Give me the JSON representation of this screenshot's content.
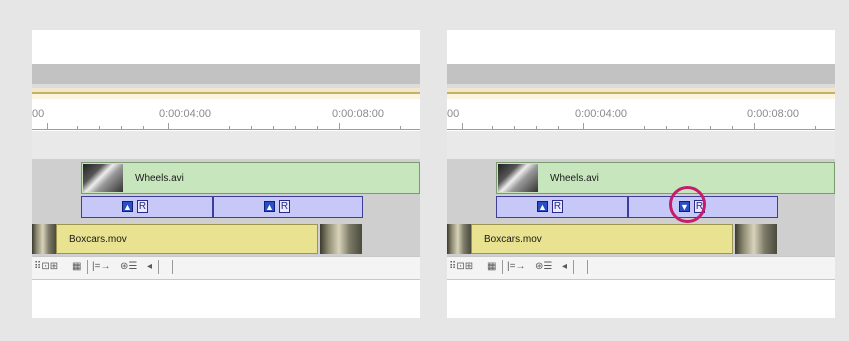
{
  "colors": {
    "background": "#e6e6e6",
    "video_clip": "#c7e6bd",
    "audio_clip": "#e8e291",
    "transition": "#c8c8f8",
    "highlight_ring": "#c61c6b"
  },
  "panels": [
    {
      "ruler": {
        "ticks": [
          "00",
          "0:00:04:00",
          "0:00:08:00"
        ]
      },
      "video_clip": {
        "name": "Wheels.avi"
      },
      "transitions": [
        {
          "direction": "up",
          "icon": "up-arrow-icon"
        },
        {
          "direction": "up",
          "icon": "up-arrow-icon"
        }
      ],
      "audio_clip": {
        "name": "Boxcars.mov"
      },
      "toolbar": {
        "icons": [
          "track-options-icon",
          "toggle-icon",
          "ruler-icon",
          "arrow-icon",
          "grid-icon",
          "scroll-left-icon"
        ]
      }
    },
    {
      "ruler": {
        "ticks": [
          "00",
          "0:00:04:00",
          "0:00:08:00"
        ]
      },
      "video_clip": {
        "name": "Wheels.avi"
      },
      "transitions": [
        {
          "direction": "up",
          "icon": "up-arrow-icon"
        },
        {
          "direction": "down",
          "icon": "down-arrow-icon",
          "highlighted": true
        }
      ],
      "audio_clip": {
        "name": "Boxcars.mov"
      },
      "toolbar": {
        "icons": [
          "track-options-icon",
          "toggle-icon",
          "ruler-icon",
          "arrow-icon",
          "grid-icon",
          "scroll-left-icon"
        ]
      }
    }
  ]
}
